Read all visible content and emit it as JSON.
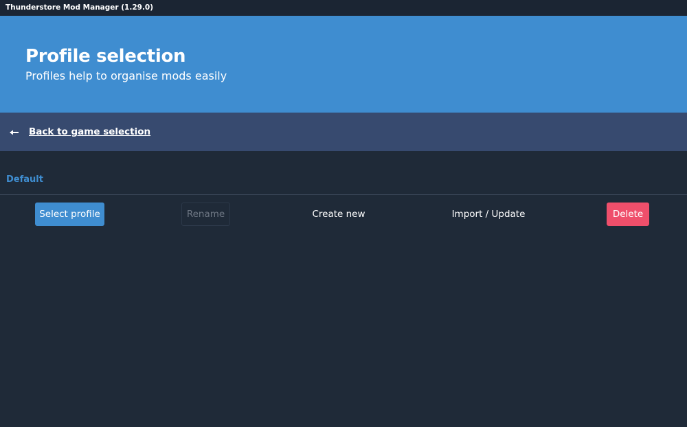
{
  "window": {
    "title": "Thunderstore Mod Manager (1.29.0)"
  },
  "hero": {
    "title": "Profile selection",
    "subtitle": "Profiles help to organise mods easily"
  },
  "nav": {
    "back_icon": "arrow-left-icon",
    "back_label": "Back to game selection"
  },
  "profiles": [
    {
      "name": "Default"
    }
  ],
  "actions": {
    "select_label": "Select profile",
    "rename_label": "Rename",
    "create_label": "Create new",
    "import_label": "Import / Update",
    "delete_label": "Delete"
  },
  "colors": {
    "hero_bg": "#3f8dd0",
    "backbar_bg": "#374a6f",
    "page_bg": "#1f2a38",
    "titlebar_bg": "#1b2533",
    "accent": "#3f8dd0",
    "danger": "#ef4f6b",
    "disabled_text": "#6e7784"
  }
}
